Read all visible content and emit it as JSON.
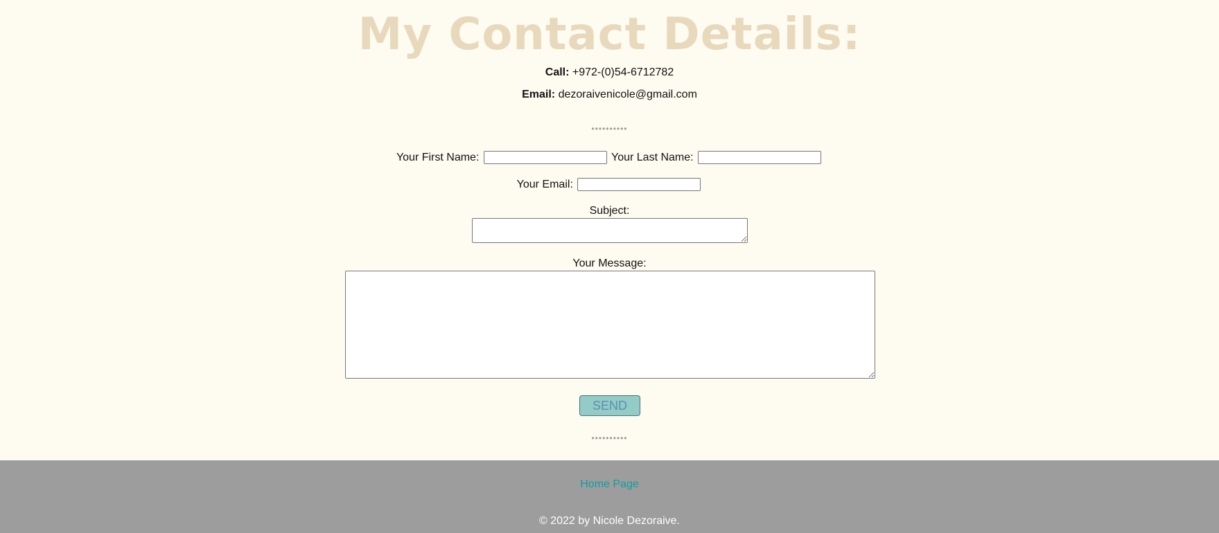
{
  "page": {
    "title": "My Contact Details:"
  },
  "contact": {
    "call_label": "Call:",
    "call_value": "+972-(0)54-6712782",
    "email_label": "Email:",
    "email_value": "dezoraivenicole@gmail.com"
  },
  "separator": "••••••••••",
  "form": {
    "first_name_label": "Your First Name:",
    "last_name_label": "Your Last Name:",
    "email_label": "Your Email:",
    "subject_label": "Subject:",
    "message_label": "Your Message:",
    "send_label": "SEND"
  },
  "footer": {
    "home_link": "Home Page",
    "copyright": "© 2022 by Nicole Dezoraive."
  },
  "colors": {
    "background": "#fefbf0",
    "title": "#e8d9bd",
    "footer": "#9d9d9d",
    "link": "#0e9da3",
    "button": "#93ccc6"
  }
}
